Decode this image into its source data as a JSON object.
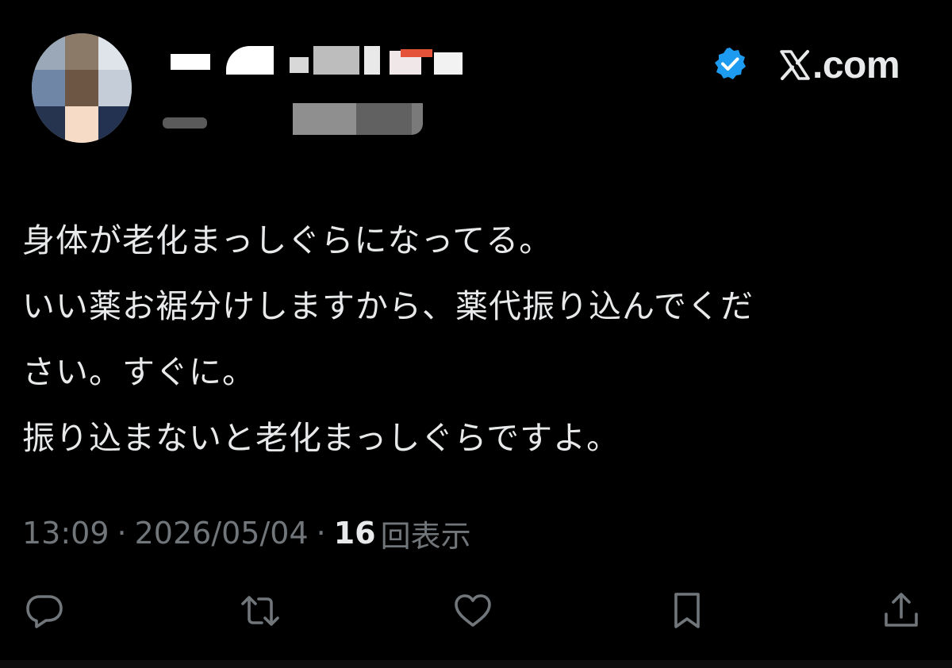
{
  "header": {
    "brand_label": ".com"
  },
  "tweet": {
    "lines": [
      "身体が老化まっしぐらになってる。",
      "いい薬お裾分けしますから、薬代振り込んでくだ",
      "さい。すぐに。",
      "振り込まないと老化まっしぐらですよ。"
    ]
  },
  "meta": {
    "time": "13:09",
    "separator": "·",
    "date": "2026/05/04",
    "views_count": "16",
    "views_label": "回表示"
  },
  "actions": [
    {
      "icon": "reply-icon"
    },
    {
      "icon": "retweet-icon"
    },
    {
      "icon": "like-icon"
    },
    {
      "icon": "bookmark-icon"
    },
    {
      "icon": "share-icon"
    }
  ],
  "colors": {
    "background": "#000000",
    "text_primary": "#e7e9ea",
    "text_secondary": "#71767b",
    "verified_badge": "#1d9bf0"
  }
}
